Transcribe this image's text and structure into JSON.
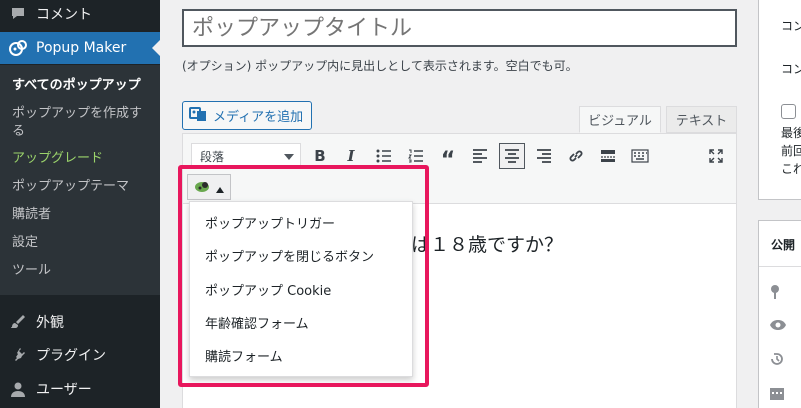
{
  "sidebar": {
    "comments_label": "コメント",
    "popup_maker_label": "Popup Maker",
    "submenu": [
      "すべてのポップアップ",
      "ポップアップを作成する",
      "アップグレード",
      "ポップアップテーマ",
      "購読者",
      "設定",
      "ツール"
    ],
    "appearance_label": "外観",
    "plugins_label": "プラグイン",
    "users_label": "ユーザー"
  },
  "editor": {
    "title_placeholder": "ポップアップタイトル",
    "title_description": "(オプション) ポップアップ内に見出しとして表示されます。空白でも可。",
    "add_media_label": "メディアを追加",
    "tab_visual": "ビジュアル",
    "tab_text": "テキスト",
    "format_select_value": "段落",
    "content_visible": "は１８歳ですか？"
  },
  "popup_menu": {
    "items": [
      "ポップアップトリガー",
      "ポップアップを閉じるボタン",
      "ポップアップ Cookie",
      "年齢確認フォーム",
      "購読フォーム"
    ]
  },
  "right_panel": {
    "line1": "コン",
    "line2": "コン",
    "checkbox_lines": [
      "最後",
      "前回",
      "これ"
    ],
    "publish_title": "公開"
  },
  "colors": {
    "sidebar_bg": "#1d2327",
    "active_menu": "#2271b1",
    "upgrade_green": "#9bd46b",
    "highlight_border": "#e8175d"
  }
}
